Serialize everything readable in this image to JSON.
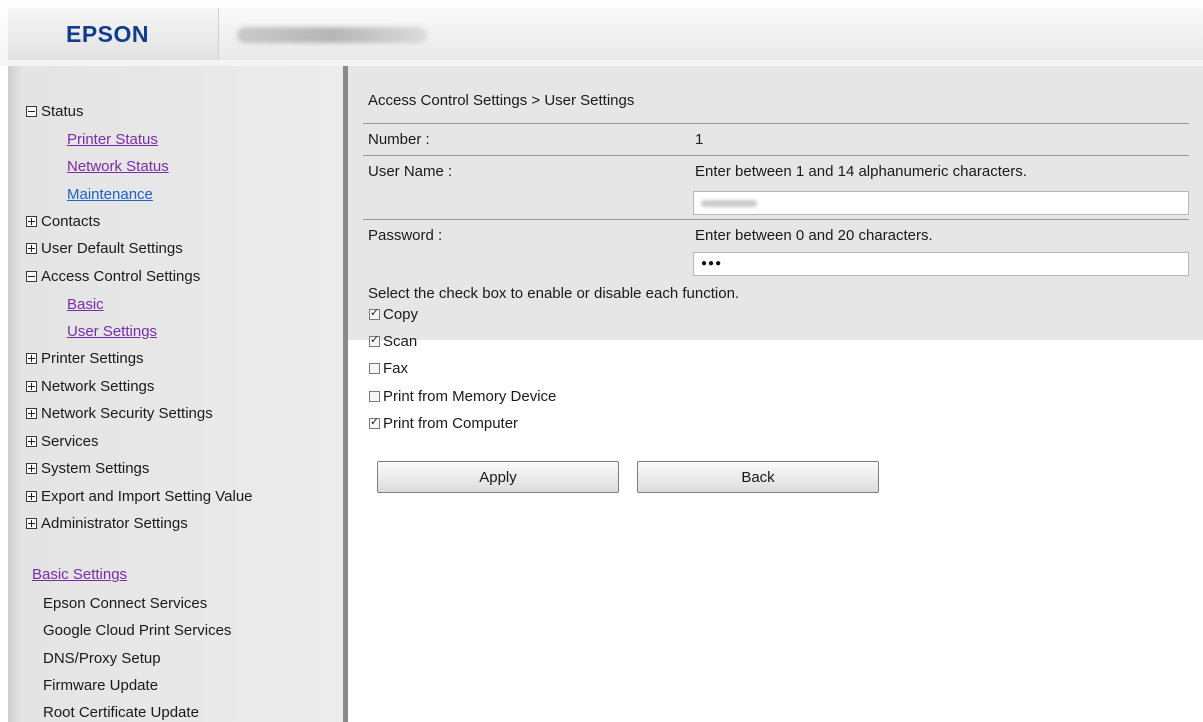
{
  "header": {
    "logo": "EPSON"
  },
  "sidebar": {
    "status": {
      "label": "Status",
      "expanded": true,
      "children": [
        "Printer Status",
        "Network Status",
        "Maintenance"
      ]
    },
    "contacts": "Contacts",
    "user_default_settings": "User Default Settings",
    "access_control": {
      "label": "Access Control Settings",
      "expanded": true,
      "children": [
        "Basic",
        "User Settings"
      ]
    },
    "printer_settings": "Printer Settings",
    "network_settings": "Network Settings",
    "network_security_settings": "Network Security Settings",
    "services": "Services",
    "system_settings": "System Settings",
    "export_import": "Export and Import Setting Value",
    "administrator_settings": "Administrator Settings",
    "basic_settings": {
      "label": "Basic Settings",
      "items": [
        "Epson Connect Services",
        "Google Cloud Print Services",
        "DNS/Proxy Setup",
        "Firmware Update",
        "Root Certificate Update"
      ]
    }
  },
  "main": {
    "breadcrumb": "Access Control Settings > User Settings",
    "number_label": "Number :",
    "number_value": "1",
    "user_name_label": "User Name :",
    "user_name_hint": "Enter between 1 and 14 alphanumeric characters.",
    "password_label": "Password :",
    "password_hint": "Enter between 0 and 20 characters.",
    "password_mask": "●●●",
    "instruction": "Select the check box to enable or disable each function.",
    "functions": [
      {
        "label": "Copy",
        "checked": true
      },
      {
        "label": "Scan",
        "checked": true
      },
      {
        "label": "Fax",
        "checked": false
      },
      {
        "label": "Print from Memory Device",
        "checked": false
      },
      {
        "label": "Print from Computer",
        "checked": true
      }
    ],
    "apply_label": "Apply",
    "back_label": "Back"
  },
  "colors": {
    "brand": "#0f3e8c",
    "link_visited": "#7a2ca8",
    "link": "#1f5fcf",
    "panel_bg": "#e6e6e6",
    "divider": "#8a8a8a"
  }
}
